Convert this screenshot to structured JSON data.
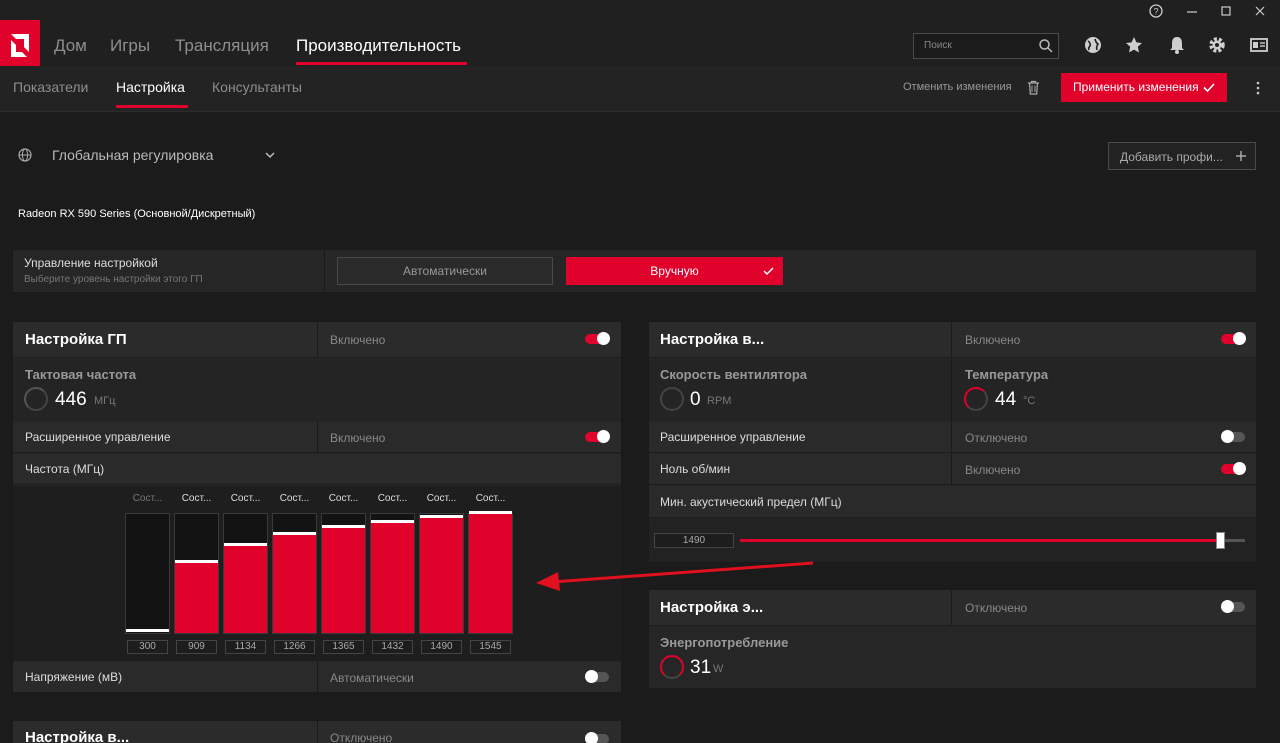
{
  "titlebar": {
    "help_icon": "help-icon",
    "minimize_icon": "minimize-icon",
    "maximize_icon": "maximize-icon",
    "close_icon": "close-icon"
  },
  "nav": {
    "tabs": [
      "Дом",
      "Игры",
      "Трансляция",
      "Производительность"
    ],
    "active_tab": "Производительность",
    "search_placeholder": "Поиск",
    "icons": [
      "search-icon",
      "globe-icon",
      "star-icon",
      "bell-icon",
      "gear-icon",
      "panel-icon"
    ]
  },
  "subnav": {
    "tabs": [
      "Показатели",
      "Настройка",
      "Консультанты"
    ],
    "active_tab": "Настройка",
    "discard_label": "Отменить изменения",
    "apply_label": "Применить изменения",
    "more_icon": "more-vertical-icon"
  },
  "profile": {
    "label": "Глобальная регулировка",
    "add_profile_label": "Добавить профи...",
    "gpu_name": "Radeon RX 590 Series (Основной/Дискретный)"
  },
  "tuning_control": {
    "title": "Управление настройкой",
    "subtitle": "Выберите уровень настройки этого ГП",
    "auto_label": "Автоматически",
    "manual_label": "Вручную"
  },
  "gpu_tuning": {
    "title": "Настройка ГП",
    "state": "Включено",
    "clock_label": "Тактовая частота",
    "clock_value": "446",
    "clock_unit": "МГц",
    "advanced_label": "Расширенное управление",
    "advanced_state": "Включено",
    "freq_label": "Частота (МГц)",
    "state_label": "Сост...",
    "states": [
      300,
      909,
      1134,
      1266,
      1365,
      1432,
      1490,
      1545
    ],
    "freq_max": 1545,
    "voltage_label": "Напряжение (мВ)",
    "voltage_state": "Автоматически"
  },
  "fan_tuning": {
    "title": "Настройка в...",
    "state": "Включено",
    "fan_speed_label": "Скорость вентилятора",
    "fan_speed_value": "0",
    "fan_speed_unit": "RPM",
    "temp_label": "Температура",
    "temp_value": "44",
    "temp_unit": "°C",
    "advanced_label": "Расширенное управление",
    "advanced_state": "Отключено",
    "zero_rpm_label": "Ноль об/мин",
    "zero_rpm_state": "Включено",
    "acoustic_label": "Мин. акустический предел (МГц)",
    "acoustic_value": "1490",
    "acoustic_fraction": 0.95
  },
  "power_tuning": {
    "title": "Настройка э...",
    "state": "Отключено",
    "power_label": "Энергопотребление",
    "power_value": "31",
    "power_unit": "W"
  },
  "vram_tuning": {
    "title": "Настройка в...",
    "state": "Отключено"
  },
  "colors": {
    "accent": "#e0022b",
    "background": "#1b1b1b",
    "panel": "#262626"
  }
}
